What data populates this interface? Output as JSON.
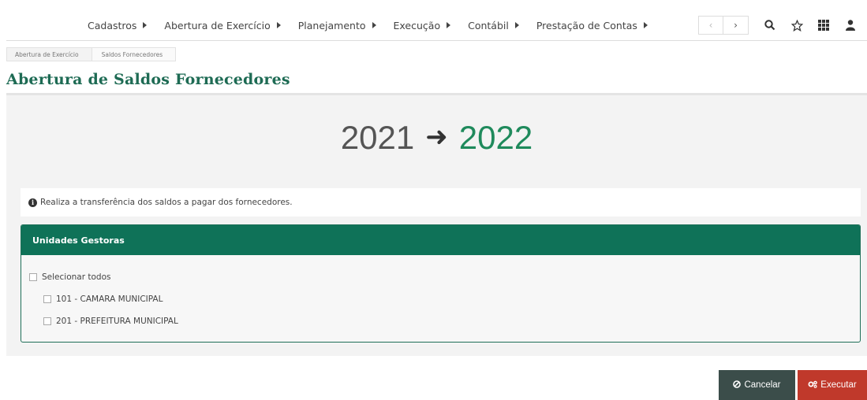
{
  "menu": {
    "items": [
      "Cadastros",
      "Abertura de Exercício",
      "Planejamento",
      "Execução",
      "Contábil",
      "Prestação de Contas"
    ]
  },
  "nav": {
    "prev": "‹",
    "next": "›"
  },
  "top_icons": [
    "search-icon",
    "star-icon",
    "grid-icon",
    "user-icon"
  ],
  "breadcrumb": {
    "item1": "Abertura de Exercício",
    "item2": "Saldos Fornecedores"
  },
  "page": {
    "title": "Abertura de Saldos Fornecedores"
  },
  "years": {
    "from": "2021",
    "arrow": "➜",
    "to": "2022"
  },
  "info": {
    "icon": "i",
    "text": "Realiza a transferência dos saldos a pagar dos fornecedores."
  },
  "units_panel": {
    "title": "Unidades Gestoras",
    "select_all": "Selecionar todos",
    "units": [
      "101 - CAMARA MUNICIPAL",
      "201 - PREFEITURA MUNICIPAL"
    ]
  },
  "buttons": {
    "cancel": "Cancelar",
    "execute": "Executar"
  },
  "colors": {
    "primary": "#0f7258",
    "title": "#1e6b54",
    "danger": "#c0392b",
    "dark": "#3b4d4a",
    "year_to": "#1f8a5c"
  }
}
